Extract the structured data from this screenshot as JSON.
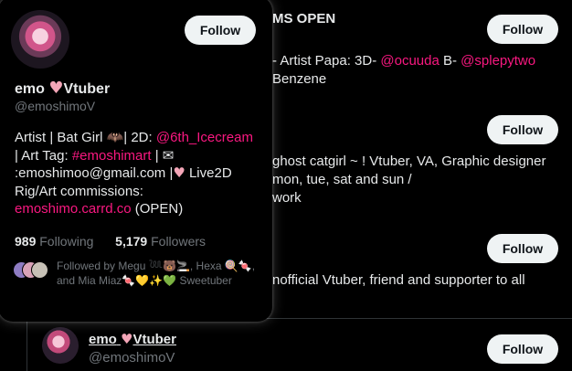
{
  "background": {
    "row1": {
      "bio_line1": "MS OPEN",
      "bio_line2_prefix": "- Artist Papa: 3D- ",
      "mention1": "@ocuuda",
      "bio_line2_mid": " B- ",
      "mention2": "@splepytwo",
      "bio_line3": "Benzene",
      "follow_label": "Follow"
    },
    "row2": {
      "bio_line1": "ghost catgirl ~ ! Vtuber, VA, Graphic designer",
      "bio_line2": "mon, tue, sat and sun /",
      "bio_line3": "work",
      "follow_label": "Follow"
    },
    "row3": {
      "bio_line1": "nofficial Vtuber, friend and supporter to all",
      "follow_label": "Follow"
    },
    "row4": {
      "name": "emo",
      "name_suffix": "Vtuber",
      "handle": "@emoshimoV",
      "follow_label": "Follow"
    }
  },
  "card": {
    "follow_label": "Follow",
    "name": "emo",
    "name_suffix": "Vtuber",
    "heart": "♥",
    "handle": "@emoshimoV",
    "bio": {
      "t1": "Artist | Bat Girl ",
      "bat": "🦇",
      "t2": "| 2D: ",
      "mention": "@6th_Icecream",
      "t3": "| Art Tag: ",
      "hashtag": "#emoshimart",
      "t4": " | ",
      "envelope": "✉",
      "t5": ":emoshimoo@gmail.com |",
      "heart": "♥",
      "t6": " Live2D Rig/Art commissions: ",
      "link": "emoshimo.carrd.co",
      "t7": " (OPEN)"
    },
    "following_count": "989",
    "following_label": "Following",
    "followers_count": "5,179",
    "followers_label": "Followers",
    "followed_by": {
      "t1": "Followed by Megu ",
      "e1": "𓆙🐻🚬",
      "t2": ", Hexa ",
      "e2": "🍭🍬",
      "t3": ", and Mia Miaz",
      "e3": "🍬💛✨💚",
      "t4": " Sweetuber"
    }
  },
  "colors": {
    "accent": "#f91880",
    "heart": "#f4a6b8",
    "muted": "#71767b",
    "button_bg": "#eff3f4"
  }
}
